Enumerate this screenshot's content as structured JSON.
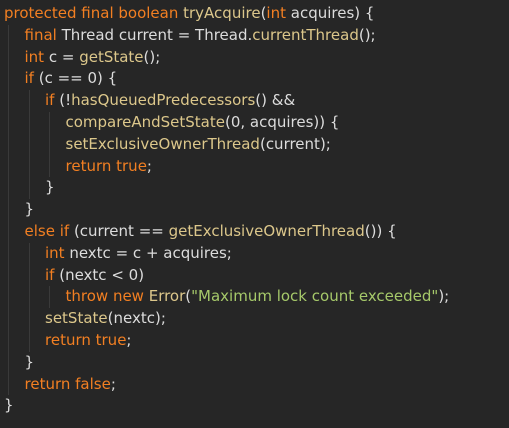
{
  "code": {
    "lines": [
      {
        "indent": 0,
        "tokens": [
          {
            "k": "kw",
            "t": "protected final boolean "
          },
          {
            "k": "fn",
            "t": "tryAcquire"
          },
          {
            "k": "pl",
            "t": "("
          },
          {
            "k": "kw",
            "t": "int "
          },
          {
            "k": "id",
            "t": "acquires"
          },
          {
            "k": "pl",
            "t": ") {"
          }
        ]
      },
      {
        "indent": 1,
        "tokens": [
          {
            "k": "kw",
            "t": "final "
          },
          {
            "k": "ty",
            "t": "Thread "
          },
          {
            "k": "id",
            "t": "current "
          },
          {
            "k": "pl",
            "t": "= "
          },
          {
            "k": "ty",
            "t": "Thread"
          },
          {
            "k": "pl",
            "t": "."
          },
          {
            "k": "fn",
            "t": "currentThread"
          },
          {
            "k": "pl",
            "t": "();"
          }
        ]
      },
      {
        "indent": 1,
        "tokens": [
          {
            "k": "kw",
            "t": "int "
          },
          {
            "k": "id",
            "t": "c "
          },
          {
            "k": "pl",
            "t": "= "
          },
          {
            "k": "fn",
            "t": "getState"
          },
          {
            "k": "pl",
            "t": "();"
          }
        ]
      },
      {
        "indent": 1,
        "tokens": [
          {
            "k": "kw",
            "t": "if "
          },
          {
            "k": "pl",
            "t": "("
          },
          {
            "k": "id",
            "t": "c "
          },
          {
            "k": "pl",
            "t": "== "
          },
          {
            "k": "num",
            "t": "0"
          },
          {
            "k": "pl",
            "t": ") {"
          }
        ]
      },
      {
        "indent": 2,
        "tokens": [
          {
            "k": "kw",
            "t": "if "
          },
          {
            "k": "pl",
            "t": "(!"
          },
          {
            "k": "fn",
            "t": "hasQueuedPredecessors"
          },
          {
            "k": "pl",
            "t": "() &&"
          }
        ]
      },
      {
        "indent": 3,
        "tokens": [
          {
            "k": "fn",
            "t": "compareAndSetState"
          },
          {
            "k": "pl",
            "t": "("
          },
          {
            "k": "num",
            "t": "0"
          },
          {
            "k": "pl",
            "t": ", "
          },
          {
            "k": "id",
            "t": "acquires"
          },
          {
            "k": "pl",
            "t": ")) {"
          }
        ]
      },
      {
        "indent": 3,
        "tokens": [
          {
            "k": "fn",
            "t": "setExclusiveOwnerThread"
          },
          {
            "k": "pl",
            "t": "("
          },
          {
            "k": "id",
            "t": "current"
          },
          {
            "k": "pl",
            "t": ");"
          }
        ]
      },
      {
        "indent": 3,
        "tokens": [
          {
            "k": "kw",
            "t": "return true"
          },
          {
            "k": "pl",
            "t": ";"
          }
        ]
      },
      {
        "indent": 2,
        "tokens": [
          {
            "k": "pl",
            "t": "}"
          }
        ]
      },
      {
        "indent": 1,
        "tokens": [
          {
            "k": "pl",
            "t": "}"
          }
        ]
      },
      {
        "indent": 1,
        "tokens": [
          {
            "k": "kw",
            "t": "else if "
          },
          {
            "k": "pl",
            "t": "("
          },
          {
            "k": "id",
            "t": "current "
          },
          {
            "k": "pl",
            "t": "== "
          },
          {
            "k": "fn",
            "t": "getExclusiveOwnerThread"
          },
          {
            "k": "pl",
            "t": "()) {"
          }
        ]
      },
      {
        "indent": 2,
        "tokens": [
          {
            "k": "kw",
            "t": "int "
          },
          {
            "k": "id",
            "t": "nextc "
          },
          {
            "k": "pl",
            "t": "= "
          },
          {
            "k": "id",
            "t": "c "
          },
          {
            "k": "pl",
            "t": "+ "
          },
          {
            "k": "id",
            "t": "acquires"
          },
          {
            "k": "pl",
            "t": ";"
          }
        ]
      },
      {
        "indent": 2,
        "tokens": [
          {
            "k": "kw",
            "t": "if "
          },
          {
            "k": "pl",
            "t": "("
          },
          {
            "k": "id",
            "t": "nextc "
          },
          {
            "k": "pl",
            "t": "< "
          },
          {
            "k": "num",
            "t": "0"
          },
          {
            "k": "pl",
            "t": ")"
          }
        ]
      },
      {
        "indent": 3,
        "tokens": [
          {
            "k": "kw",
            "t": "throw new "
          },
          {
            "k": "fn",
            "t": "Error"
          },
          {
            "k": "pl",
            "t": "("
          },
          {
            "k": "str",
            "t": "\"Maximum lock count exceeded\""
          },
          {
            "k": "pl",
            "t": ");"
          }
        ]
      },
      {
        "indent": 2,
        "tokens": [
          {
            "k": "fn",
            "t": "setState"
          },
          {
            "k": "pl",
            "t": "("
          },
          {
            "k": "id",
            "t": "nextc"
          },
          {
            "k": "pl",
            "t": ");"
          }
        ]
      },
      {
        "indent": 2,
        "tokens": [
          {
            "k": "kw",
            "t": "return true"
          },
          {
            "k": "pl",
            "t": ";"
          }
        ]
      },
      {
        "indent": 1,
        "tokens": [
          {
            "k": "pl",
            "t": "}"
          }
        ]
      },
      {
        "indent": 1,
        "tokens": [
          {
            "k": "kw",
            "t": "return false"
          },
          {
            "k": "pl",
            "t": ";"
          }
        ]
      },
      {
        "indent": 0,
        "tokens": [
          {
            "k": "pl",
            "t": "}"
          }
        ]
      }
    ]
  },
  "colors": {
    "background": "#262626",
    "keyword": "#f27f22",
    "method": "#dcc78b",
    "string": "#a6c96a",
    "text": "#dcdcdc",
    "indent_guide": "#3a3a3a"
  }
}
